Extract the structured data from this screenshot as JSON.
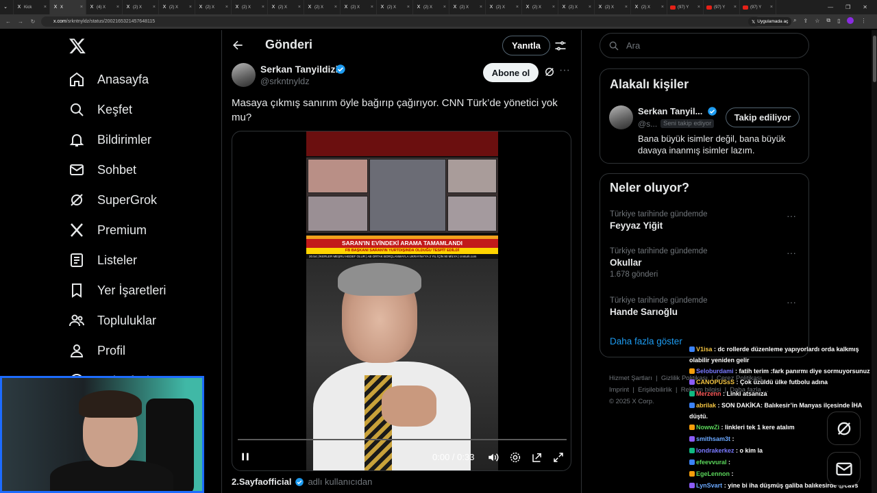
{
  "browser": {
    "tabs": [
      {
        "label": "Kick"
      },
      {
        "label": "X"
      },
      {
        "label": "(4) X"
      },
      {
        "label": "(2) X"
      },
      {
        "label": "(2) X"
      },
      {
        "label": "(2) X"
      },
      {
        "label": "(2) X"
      },
      {
        "label": "(2) X"
      },
      {
        "label": "(2) X"
      },
      {
        "label": "(2) X"
      },
      {
        "label": "(2) X"
      },
      {
        "label": "(2) X"
      },
      {
        "label": "(2) X"
      },
      {
        "label": "(2) X"
      },
      {
        "label": "(2) X"
      },
      {
        "label": "(2) X"
      },
      {
        "label": "(2) X"
      },
      {
        "label": "(2) X"
      },
      {
        "label": "(97) Y"
      },
      {
        "label": "(97) Y"
      },
      {
        "label": "(97) Y"
      }
    ],
    "url_host": "x.com",
    "url_path": "/srkntnyldz/status/2002165321457648115",
    "open_in_app": "Uygulamada aç",
    "accent": "#8a2be2"
  },
  "nav": {
    "items": [
      {
        "label": "Anasayfa",
        "icon": "home-icon"
      },
      {
        "label": "Keşfet",
        "icon": "search-icon"
      },
      {
        "label": "Bildirimler",
        "icon": "bell-icon"
      },
      {
        "label": "Sohbet",
        "icon": "mail-icon"
      },
      {
        "label": "SuperGrok",
        "icon": "grok-icon"
      },
      {
        "label": "Premium",
        "icon": "x-icon"
      },
      {
        "label": "Listeler",
        "icon": "list-icon"
      },
      {
        "label": "Yer İşaretleri",
        "icon": "bookmark-icon"
      },
      {
        "label": "Topluluklar",
        "icon": "people-icon"
      },
      {
        "label": "Profil",
        "icon": "person-icon"
      },
      {
        "label": "Daha fazla",
        "icon": "more-icon"
      }
    ]
  },
  "header": {
    "title": "Gönderi",
    "reply_label": "Yanıtla"
  },
  "post": {
    "author_name": "Serkan Tanyildizi",
    "author_handle": "@srkntnyldz",
    "subscribe_label": "Abone ol",
    "text": "Masaya çıkmış sanırım öyle bağırıp çağırıyor. CNN Türk’de yönetici yok mu?",
    "video": {
      "banner_main": "SARAN'IN EVİNDEKİ ARAMA TAMAMLANDI",
      "banner_sub": "FB BAŞKANI SARAN'IN YURTDIŞINDA OLDUĞU TESPİT EDİLDİ",
      "ticker": "20.54 | İKERLER MEŞRU HEDEF OLUR | AB ORTAK BORÇLANMAYLA UKRAYNA'YA 2 YIL İÇİN 90 MİLYA | cnnturk.com",
      "time": "0:00 / 0:33",
      "progress": 0
    },
    "source_name": "2.Sayfaofficial",
    "source_rest": "adlı kullanıcıdan"
  },
  "right": {
    "search_placeholder": "Ara",
    "related_title": "Alakalı kişiler",
    "related_person": {
      "name": "Serkan Tanyil...",
      "handle": "@s...",
      "follows_you": "Seni takip ediyor",
      "button": "Takip ediliyor",
      "bio": "Bana büyük isimler değil, bana büyük davaya inanmış isimler lazım."
    },
    "trends_title": "Neler oluyor?",
    "trends": [
      {
        "context": "Türkiye tarihinde gündemde",
        "name": "Feyyaz Yiğit",
        "count": ""
      },
      {
        "context": "Türkiye tarihinde gündemde",
        "name": "Okullar",
        "count": "1.678 gönderi"
      },
      {
        "context": "Türkiye tarihinde gündemde",
        "name": "Hande Sarıoğlu",
        "count": ""
      }
    ],
    "show_more": "Daha fazla göster",
    "footer": {
      "l1": "Hizmet Şartları",
      "l2": "Gizlilik Politikası",
      "l3": "Çerez Politikası",
      "l4": "Imprint",
      "l5": "Erişilebilirlik",
      "l6": "Reklam bilgisi",
      "l7": "Daha fazla ...",
      "copy": "© 2025 X Corp."
    }
  },
  "chat": [
    {
      "user": "V1isa",
      "color": "#f5c542",
      "msg": ": dc rollerde düzenleme yapıyorlardı orda kalkmış olabilir yeniden gelir"
    },
    {
      "user": "Seloburdami",
      "color": "#7a7aff",
      "msg": ": fatih terim :fark panırmı diye sormuyorsunuz"
    },
    {
      "user": "CANOPUSsS",
      "color": "#f5c542",
      "msg": ": Çok üzüldü ülke futbolu adına"
    },
    {
      "user": "Merzenn",
      "color": "#ff5b5b",
      "msg": ": Linki atsanıza"
    },
    {
      "user": "abrilak",
      "color": "#f5c542",
      "msg": ": SON DAKİKA: Balıkesir’in Manyas ilçesinde İHA düştü."
    },
    {
      "user": "NowwZi",
      "color": "#5bd65b",
      "msg": ": linkleri tek 1 kere atalım"
    },
    {
      "user": "smithsam3t",
      "color": "#6aa8ff",
      "msg": ":"
    },
    {
      "user": "londrakerkez",
      "color": "#7a7aff",
      "msg": ": o kim la"
    },
    {
      "user": "efeevvural",
      "color": "#5bd65b",
      "msg": ":"
    },
    {
      "user": "EgeLennon",
      "color": "#5bd65b",
      "msg": ":"
    },
    {
      "user": "LynSvart",
      "color": "#6aa8ff",
      "msg": ": yine bi iha düşmüş galiba balıkesirde @cavs"
    }
  ]
}
